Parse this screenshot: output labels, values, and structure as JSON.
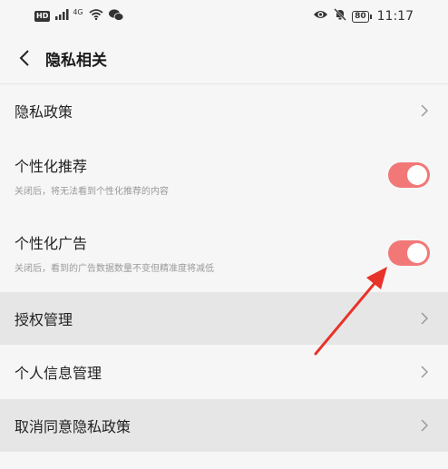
{
  "status_bar": {
    "hd_badge": "HD",
    "network_type": "4G",
    "battery_level": "80",
    "time": "11:17"
  },
  "header": {
    "title": "隐私相关"
  },
  "rows": [
    {
      "label": "隐私政策"
    },
    {
      "label": "个性化推荐",
      "subtitle": "关闭后，将无法看到个性化推荐的内容",
      "toggle_on": true
    },
    {
      "label": "个性化广告",
      "subtitle": "关闭后，看到的广告数据数量不变但精准度将减低",
      "toggle_on": true
    },
    {
      "label": "授权管理"
    },
    {
      "label": "个人信息管理"
    },
    {
      "label": "取消同意隐私政策"
    }
  ],
  "colors": {
    "toggle_on": "#f27878",
    "annotation_arrow": "#e8322a",
    "highlight_row": "#e6e6e6"
  }
}
